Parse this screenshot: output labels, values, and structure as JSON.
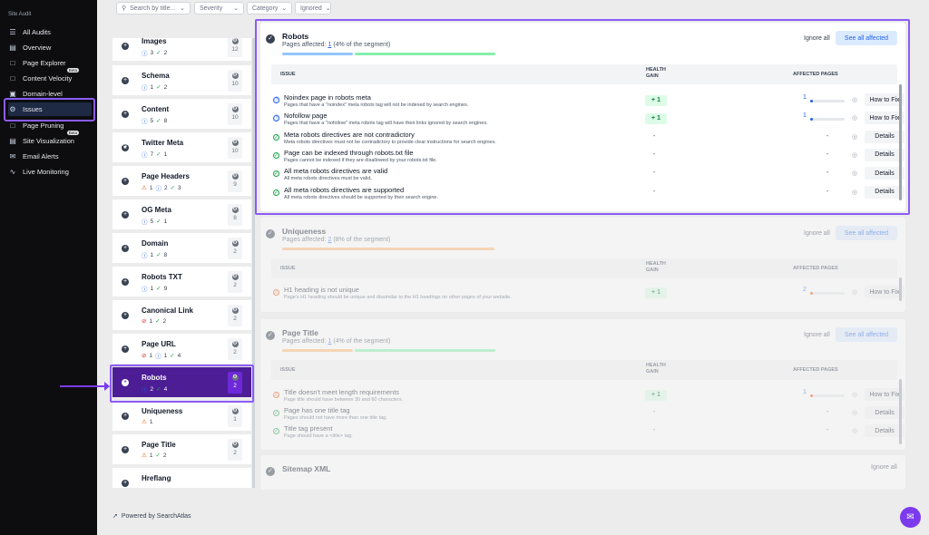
{
  "sidebar": {
    "title": "Site Audit",
    "items": [
      {
        "label": "All Audits",
        "icon": "list-icon",
        "beta": ""
      },
      {
        "label": "Overview",
        "icon": "chart-icon",
        "beta": ""
      },
      {
        "label": "Page Explorer",
        "icon": "file-icon",
        "beta": ""
      },
      {
        "label": "Content Velocity",
        "icon": "file-icon",
        "beta": "Beta"
      },
      {
        "label": "Domain-level",
        "icon": "folder-icon",
        "beta": ""
      },
      {
        "label": "Issues",
        "icon": "bug-icon",
        "beta": ""
      },
      {
        "label": "Page Pruning",
        "icon": "file-icon",
        "beta": ""
      },
      {
        "label": "Site Visualization",
        "icon": "chart-icon",
        "beta": "Beta"
      },
      {
        "label": "Email Alerts",
        "icon": "mail-icon",
        "beta": ""
      },
      {
        "label": "Live Monitoring",
        "icon": "pulse-icon",
        "beta": ""
      }
    ]
  },
  "filters": {
    "search_placeholder": "Search by title...",
    "severity": "Severity",
    "category": "Category",
    "ignored": "Ignored"
  },
  "categories": [
    {
      "name": "Images",
      "meta": [
        {
          "t": "info",
          "v": "3"
        },
        {
          "t": "ok",
          "v": "2"
        }
      ],
      "count": "12"
    },
    {
      "name": "Schema",
      "meta": [
        {
          "t": "info",
          "v": "1"
        },
        {
          "t": "ok",
          "v": "2"
        }
      ],
      "count": "10"
    },
    {
      "name": "Content",
      "meta": [
        {
          "t": "info",
          "v": "5"
        },
        {
          "t": "ok",
          "v": "8"
        }
      ],
      "count": "10"
    },
    {
      "name": "Twitter Meta",
      "meta": [
        {
          "t": "info",
          "v": "7"
        },
        {
          "t": "ok",
          "v": "1"
        }
      ],
      "count": "10"
    },
    {
      "name": "Page Headers",
      "meta": [
        {
          "t": "warn",
          "v": "1"
        },
        {
          "t": "info",
          "v": "2"
        },
        {
          "t": "ok",
          "v": "3"
        }
      ],
      "count": "9"
    },
    {
      "name": "OG Meta",
      "meta": [
        {
          "t": "info",
          "v": "5"
        },
        {
          "t": "ok",
          "v": "1"
        }
      ],
      "count": "8"
    },
    {
      "name": "Domain",
      "meta": [
        {
          "t": "info",
          "v": "1"
        },
        {
          "t": "ok",
          "v": "8"
        }
      ],
      "count": "2"
    },
    {
      "name": "Robots TXT",
      "meta": [
        {
          "t": "info",
          "v": "1"
        },
        {
          "t": "ok",
          "v": "9"
        }
      ],
      "count": "2"
    },
    {
      "name": "Canonical Link",
      "meta": [
        {
          "t": "err",
          "v": "1"
        },
        {
          "t": "ok",
          "v": "2"
        }
      ],
      "count": "2"
    },
    {
      "name": "Page URL",
      "meta": [
        {
          "t": "err",
          "v": "1"
        },
        {
          "t": "info",
          "v": "1"
        },
        {
          "t": "ok",
          "v": "4"
        }
      ],
      "count": "2"
    },
    {
      "name": "Robots",
      "meta": [
        {
          "t": "info",
          "v": "2"
        },
        {
          "t": "ok",
          "v": "4"
        }
      ],
      "count": "2"
    },
    {
      "name": "Uniqueness",
      "meta": [
        {
          "t": "warn",
          "v": "1"
        }
      ],
      "count": "1"
    },
    {
      "name": "Page Title",
      "meta": [
        {
          "t": "warn",
          "v": "1"
        },
        {
          "t": "ok",
          "v": "2"
        }
      ],
      "count": "2"
    },
    {
      "name": "Hreflang",
      "meta": [],
      "count": ""
    }
  ],
  "robots_panel": {
    "title": "Robots",
    "sub_prefix": "Pages affected: ",
    "sub_link": "1",
    "sub_suffix": " (4% of the segment)",
    "ignore_all": "Ignore all",
    "see_all": "See all affected",
    "th_issue": "Issue",
    "th_gain": "Health Gain",
    "th_affected": "Affected Pages",
    "rows": [
      {
        "icon": "info",
        "title": "Noindex page in robots meta",
        "desc": "Pages that have a \"noindex\" meta robots tag will not be indexed by search engines.",
        "gain": "+ 1",
        "affected": "1",
        "btn": "How to Fix"
      },
      {
        "icon": "info",
        "title": "Nofollow page",
        "desc": "Pages that have a \"nofollow\" meta robots tag will have their links ignored by search engines.",
        "gain": "+ 1",
        "affected": "1",
        "btn": "How to Fix"
      },
      {
        "icon": "ok",
        "title": "Meta robots directives are not contradictory",
        "desc": "Meta robots directives must not be contradictory to provide clear instructions for search engines.",
        "gain": "-",
        "affected": "-",
        "btn": "Details"
      },
      {
        "icon": "ok",
        "title": "Page can be indexed through robots.txt file",
        "desc": "Pages cannot be indexed if they are disallowed by your robots.txt file.",
        "gain": "-",
        "affected": "-",
        "btn": "Details"
      },
      {
        "icon": "ok",
        "title": "All meta robots directives are valid",
        "desc": "All meta robots directives must be valid.",
        "gain": "-",
        "affected": "-",
        "btn": "Details"
      },
      {
        "icon": "ok",
        "title": "All meta robots directives are supported",
        "desc": "All meta robots directives should be supported by their search engine.",
        "gain": "-",
        "affected": "-",
        "btn": "Details"
      }
    ]
  },
  "uniqueness_panel": {
    "title": "Uniqueness",
    "sub_prefix": "Pages affected: ",
    "sub_link": "2",
    "sub_suffix": " (8% of the segment)",
    "ignore_all": "Ignore all",
    "see_all": "See all affected",
    "th_issue": "Issue",
    "th_gain": "Health Gain",
    "th_affected": "Affected Pages",
    "rows": [
      {
        "icon": "warn",
        "title": "H1 heading is not unique",
        "desc": "Page's H1 heading should be unique and dissimilar to the H1 headings on other pages of your website.",
        "gain": "+ 1",
        "affected": "2",
        "btn": "How to Fix"
      }
    ]
  },
  "pagetitle_panel": {
    "title": "Page Title",
    "sub_prefix": "Pages affected: ",
    "sub_link": "1",
    "sub_suffix": " (4% of the segment)",
    "ignore_all": "Ignore all",
    "see_all": "See all affected",
    "th_issue": "Issue",
    "th_gain": "Health Gain",
    "th_affected": "Affected Pages",
    "rows": [
      {
        "icon": "warn",
        "title": "Title doesn't meet length requirements",
        "desc": "Page title should have between 30 and 60 characters.",
        "gain": "+ 1",
        "affected": "1",
        "btn": "How to Fix"
      },
      {
        "icon": "ok",
        "title": "Page has one title tag",
        "desc": "Pages should not have more than one title tag.",
        "gain": "-",
        "affected": "-",
        "btn": "Details"
      },
      {
        "icon": "ok",
        "title": "Title tag present",
        "desc": "Page should have a <title> tag.",
        "gain": "-",
        "affected": "-",
        "btn": "Details"
      }
    ]
  },
  "sitemap_panel": {
    "title": "Sitemap XML",
    "ignore_all": "Ignore all"
  },
  "footer": {
    "powered": "Powered by SearchAtlas"
  },
  "colors": {
    "accent": "#7c3aed",
    "selected": "#4c1d95",
    "info": "#2563eb",
    "ok": "#16a34a",
    "warn": "#ea580c"
  }
}
